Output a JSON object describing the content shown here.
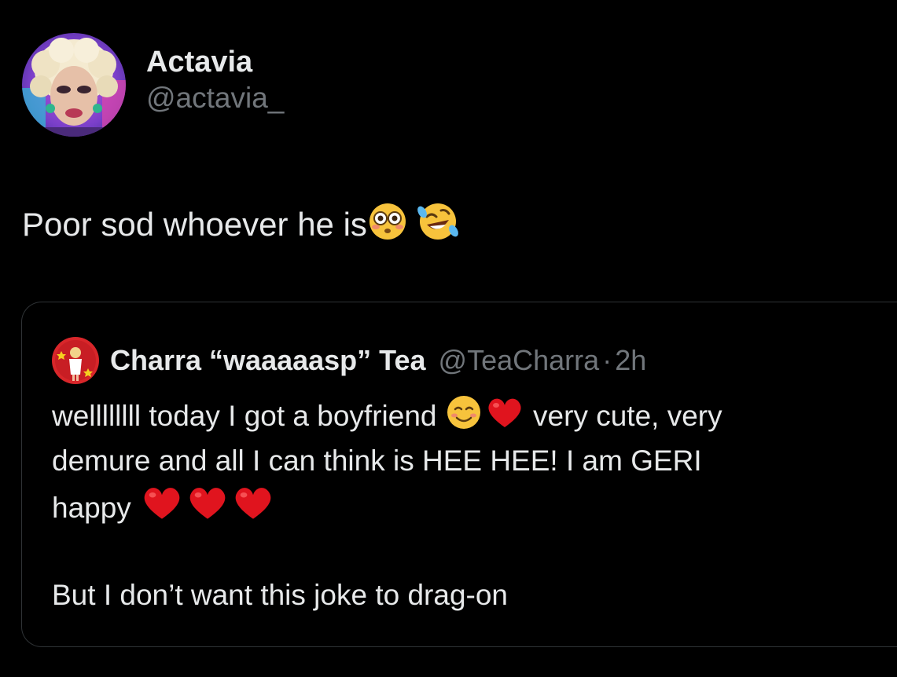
{
  "author": {
    "display_name": "Actavia",
    "handle": "@actavia_"
  },
  "tweet": {
    "text": "Poor sod whoever he is",
    "emojis": [
      "flushed-face-emoji",
      "rolling-on-floor-laughing-emoji"
    ]
  },
  "quoted_tweet": {
    "display_name": "Charra “waaaaasp” Tea",
    "handle": "@TeaCharra",
    "separator": "·",
    "time": "2h",
    "line1_part1": "wellllllll today I got a boyfriend",
    "line1_part2": "very cute, very",
    "line2": "demure and all I can think is HEE HEE! I am GERI",
    "line3": "happy",
    "line5": "But I don’t want this joke to drag-on"
  },
  "colors": {
    "background": "#000000",
    "primary_text": "#e7e9ea",
    "secondary_text": "#71767b",
    "border": "#2f3336",
    "heart": "#e0141e"
  }
}
